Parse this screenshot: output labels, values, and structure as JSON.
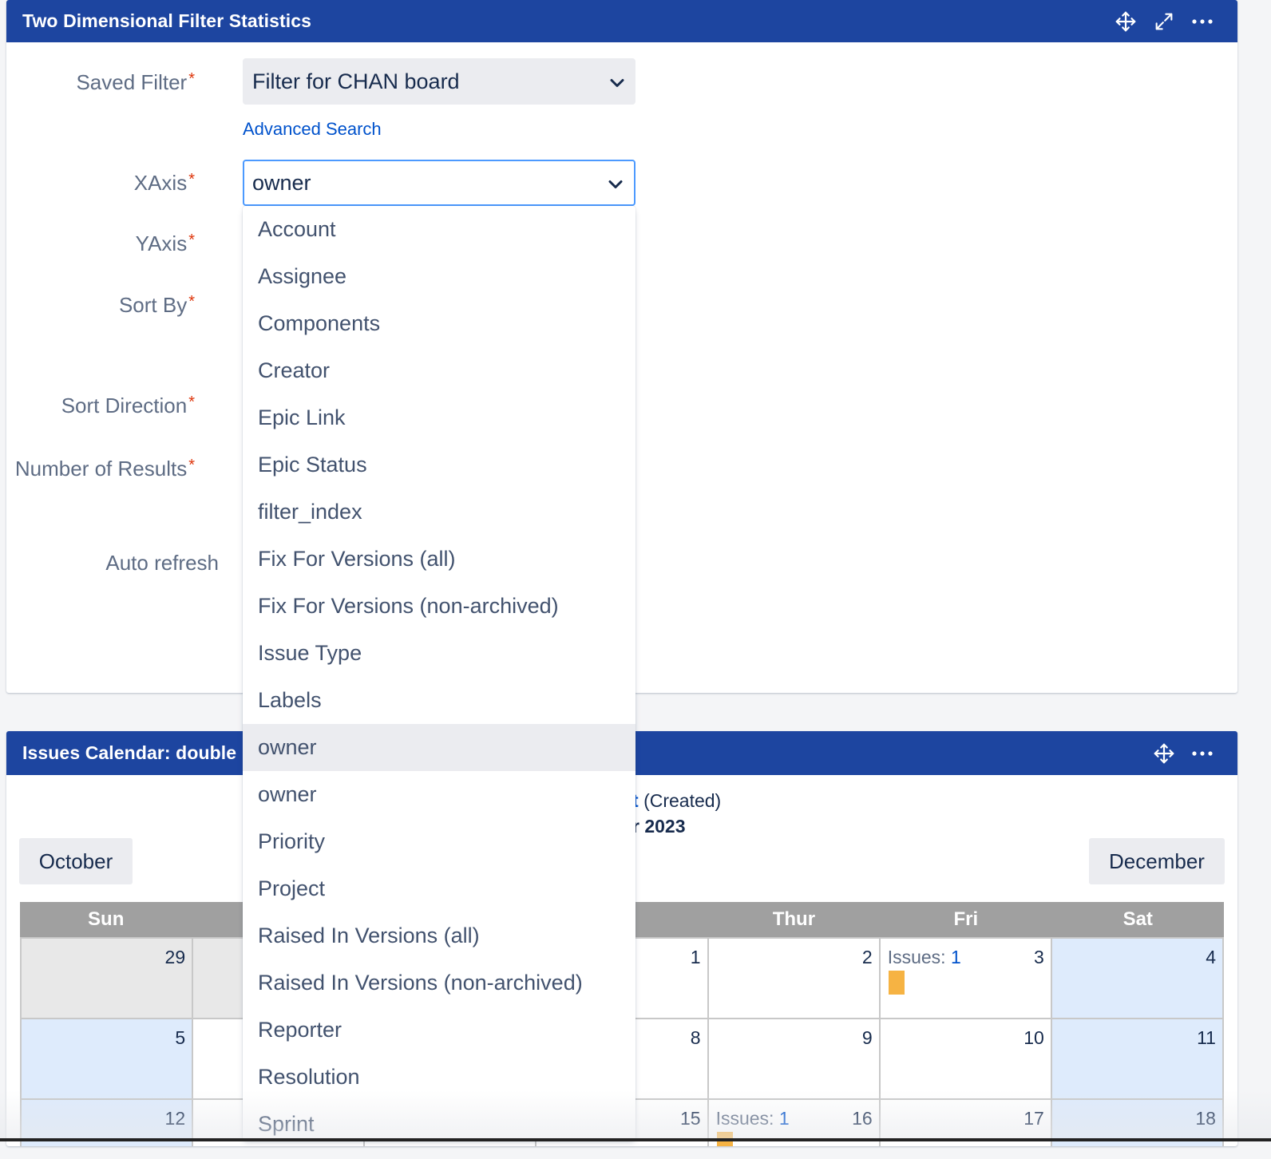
{
  "filter_gadget": {
    "title": "Two Dimensional Filter Statistics",
    "labels": {
      "saved_filter": "Saved Filter",
      "xaxis": "XAxis",
      "yaxis": "YAxis",
      "sort_by": "Sort By",
      "sort_direction": "Sort Direction",
      "number_of_results": "Number of Results",
      "auto_refresh": "Auto refresh"
    },
    "required_mark": "*",
    "saved_filter_value": "Filter for CHAN board",
    "advanced_search": "Advanced Search",
    "xaxis_value": "owner",
    "icons": [
      "move-icon",
      "expand-icon",
      "more-icon"
    ]
  },
  "xaxis_dropdown": {
    "options": [
      "Account",
      "Assignee",
      "Components",
      "Creator",
      "Epic Link",
      "Epic Status",
      "filter_index",
      "Fix For Versions (all)",
      "Fix For Versions (non-archived)",
      "Issue Type",
      "Labels",
      "owner",
      "owner",
      "Priority",
      "Project",
      "Raised In Versions (all)",
      "Raised In Versions (non-archived)",
      "Reporter",
      "Resolution",
      "Sprint"
    ],
    "highlighted_index": 11
  },
  "calendar_gadget": {
    "title": "Issues Calendar: double",
    "subtitle_link": "t",
    "subtitle_suffix": "(Created)",
    "month_label": "r 2023",
    "prev_button": "October",
    "next_button": "December",
    "weekdays": [
      "Sun",
      "",
      "",
      "d",
      "Thur",
      "Fri",
      "Sat"
    ],
    "issues_label": "Issues:",
    "rows": [
      [
        {
          "day": "29",
          "type": "other"
        },
        {
          "day": "",
          "type": "other"
        },
        {
          "day": "",
          "type": "normal"
        },
        {
          "day": "1",
          "type": "normal"
        },
        {
          "day": "2",
          "type": "normal"
        },
        {
          "day": "3",
          "type": "normal",
          "issues": "1"
        },
        {
          "day": "4",
          "type": "weekend"
        }
      ],
      [
        {
          "day": "5",
          "type": "weekend"
        },
        {
          "day": "",
          "type": "normal"
        },
        {
          "day": "",
          "type": "normal"
        },
        {
          "day": "8",
          "type": "normal"
        },
        {
          "day": "9",
          "type": "normal"
        },
        {
          "day": "10",
          "type": "normal"
        },
        {
          "day": "11",
          "type": "weekend"
        }
      ],
      [
        {
          "day": "12",
          "type": "weekend"
        },
        {
          "day": "",
          "type": "normal"
        },
        {
          "day": "",
          "type": "normal"
        },
        {
          "day": "15",
          "type": "normal"
        },
        {
          "day": "16",
          "type": "normal",
          "issues": "1"
        },
        {
          "day": "17",
          "type": "normal"
        },
        {
          "day": "18",
          "type": "weekend"
        }
      ]
    ],
    "colors": {
      "issue_bar": "#f6b343",
      "weekend": "#deebfc",
      "header": "#1d45a0"
    }
  }
}
